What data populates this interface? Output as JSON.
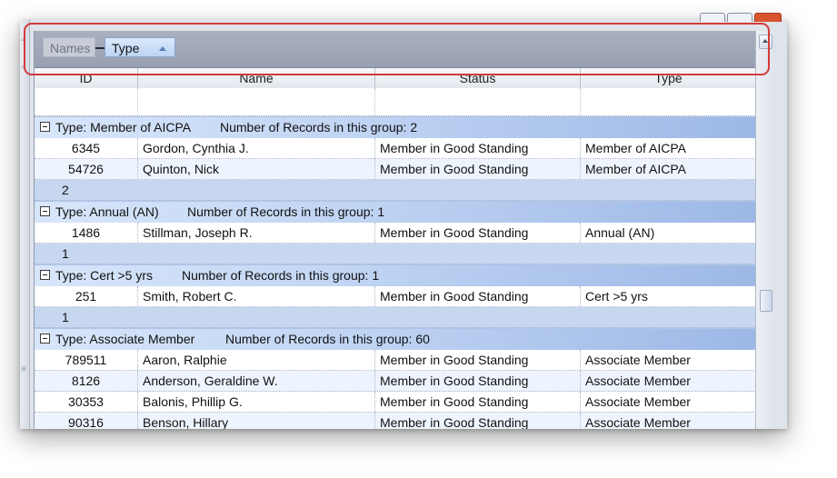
{
  "group_panel": {
    "chips": [
      {
        "label": "Names",
        "active": false
      },
      {
        "label": "Type",
        "active": true,
        "sort": "ascending"
      }
    ]
  },
  "columns": [
    "ID",
    "Name",
    "Status",
    "Type"
  ],
  "groups": [
    {
      "label": "Type: Member of AICPA",
      "count_text": "Number of Records in this group: 2",
      "rows": [
        {
          "id": "6345",
          "name": "Gordon, Cynthia J.",
          "status": "Member in Good Standing",
          "type": "Member of AICPA"
        },
        {
          "id": "54726",
          "name": "Quinton, Nick",
          "status": "Member in Good Standing",
          "type": "Member of AICPA"
        }
      ],
      "footer": "2"
    },
    {
      "label": "Type: Annual (AN)",
      "count_text": "Number of Records in this group: 1",
      "rows": [
        {
          "id": "1486",
          "name": "Stillman, Joseph R.",
          "status": "Member in Good Standing",
          "type": "Annual (AN)"
        }
      ],
      "footer": "1"
    },
    {
      "label": "Type: Cert >5 yrs",
      "count_text": "Number of Records in this group: 1",
      "rows": [
        {
          "id": "251",
          "name": "Smith, Robert C.",
          "status": "Member in Good Standing",
          "type": "Cert >5 yrs"
        }
      ],
      "footer": "1"
    },
    {
      "label": "Type: Associate Member",
      "count_text": "Number of Records in this group: 60",
      "rows": [
        {
          "id": "789511",
          "name": "Aaron, Ralphie",
          "status": "Member in Good Standing",
          "type": "Associate Member"
        },
        {
          "id": "8126",
          "name": "Anderson, Geraldine W.",
          "status": "Member in Good Standing",
          "type": "Associate Member"
        },
        {
          "id": "30353",
          "name": "Balonis, Phillip G.",
          "status": "Member in Good Standing",
          "type": "Associate Member"
        },
        {
          "id": "90316",
          "name": "Benson, Hillary",
          "status": "Member in Good Standing",
          "type": "Associate Member"
        }
      ],
      "footer": ""
    }
  ],
  "colors": {
    "callout": "#d43a3a",
    "group_panel": "#a8b0c0",
    "group_row": "#c3d6f4",
    "alt_row": "#eef4fd"
  },
  "icons": {
    "collapse": "minus-box-icon",
    "sort": "sort-ascending-icon",
    "scroll_up": "scroll-up-arrow-icon"
  }
}
